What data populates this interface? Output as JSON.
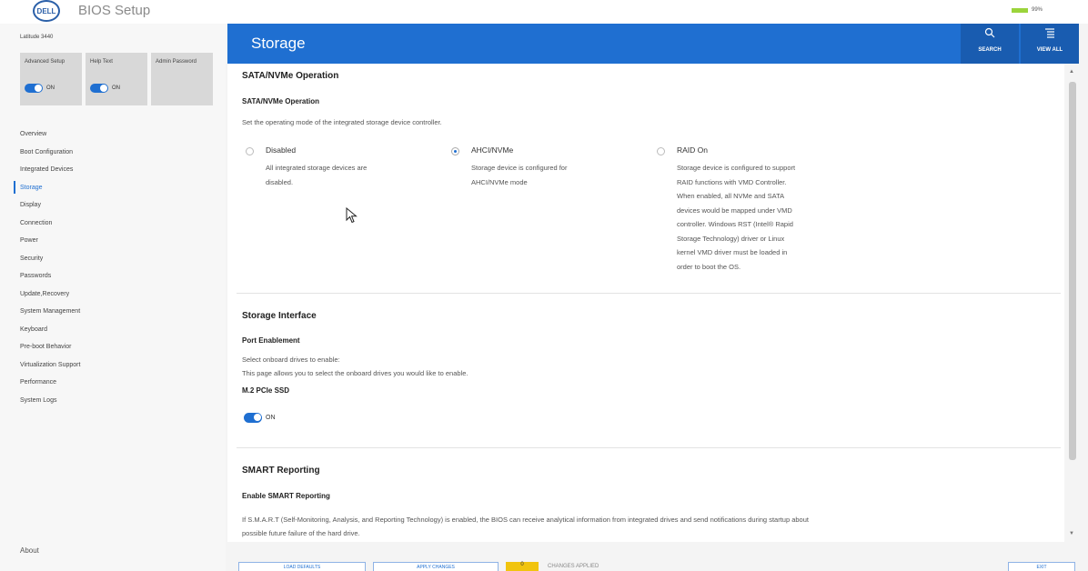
{
  "app": {
    "logo": "DELL",
    "title": "BIOS Setup",
    "battery_pct": "99%"
  },
  "sidebar": {
    "model": "Latitude 3440",
    "tiles": [
      {
        "label": "Advanced Setup",
        "toggle_state": "ON"
      },
      {
        "label": "Help Text",
        "toggle_state": "ON"
      },
      {
        "label": "Admin Password",
        "toggle_state": ""
      }
    ],
    "items": [
      {
        "label": "Overview"
      },
      {
        "label": "Boot Configuration"
      },
      {
        "label": "Integrated Devices"
      },
      {
        "label": "Storage"
      },
      {
        "label": "Display"
      },
      {
        "label": "Connection"
      },
      {
        "label": "Power"
      },
      {
        "label": "Security"
      },
      {
        "label": "Passwords"
      },
      {
        "label": "Update,Recovery"
      },
      {
        "label": "System Management"
      },
      {
        "label": "Keyboard"
      },
      {
        "label": "Pre-boot Behavior"
      },
      {
        "label": "Virtualization Support"
      },
      {
        "label": "Performance"
      },
      {
        "label": "System Logs"
      }
    ],
    "active_item": "Storage",
    "about": "About"
  },
  "header": {
    "title": "Storage",
    "search_label": "SEARCH",
    "view_all_label": "VIEW ALL",
    "accent_color": "#1f6fd1"
  },
  "sata": {
    "section_title": "SATA/NVMe Operation",
    "subtitle": "SATA/NVMe Operation",
    "description": "Set the operating mode of the integrated storage device controller.",
    "options": [
      {
        "label": "Disabled",
        "desc": [
          "All integrated storage devices are",
          "disabled."
        ],
        "selected": false
      },
      {
        "label": "AHCI/NVMe",
        "desc": [
          "Storage device is configured for",
          "AHCI/NVMe mode"
        ],
        "selected": true
      },
      {
        "label": "RAID On",
        "desc": [
          "Storage device is configured to support",
          "RAID functions with VMD Controller.",
          "When enabled, all NVMe and SATA",
          "devices would be mapped under VMD",
          "controller. Windows RST (Intel® Rapid",
          "Storage Technology) driver or Linux",
          "kernel VMD driver must be loaded in",
          "order to boot the OS."
        ],
        "selected": false
      }
    ]
  },
  "storage_interface": {
    "section_title": "Storage Interface",
    "subtitle": "Port Enablement",
    "desc_line1": "Select onboard drives to enable:",
    "desc_line2": "This page allows you to select the onboard drives you would like to enable.",
    "drive_label": "M.2 PCIe SSD",
    "drive_state": "ON"
  },
  "smart": {
    "section_title": "SMART Reporting",
    "subtitle": "Enable SMART Reporting",
    "desc_line1": "If S.M.A.R.T (Self-Monitoring, Analysis, and Reporting Technology) is enabled, the BIOS can receive analytical information from integrated drives and send notifications during startup about",
    "desc_line2": "possible future failure of the hard drive."
  },
  "footer": {
    "load_defaults": "LOAD DEFAULTS",
    "apply_changes": "APPLY CHANGES",
    "changes_count": "0",
    "changes_text": "CHANGES APPLIED",
    "exit": "EXIT"
  }
}
